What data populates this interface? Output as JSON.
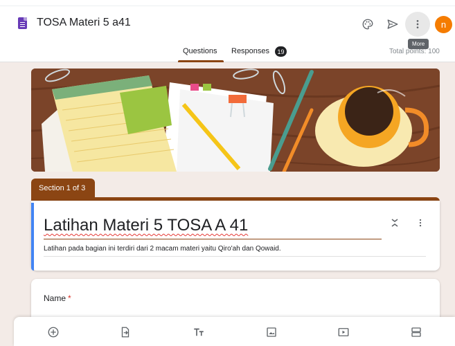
{
  "header": {
    "title": "TOSA Materi 5 a41",
    "tooltip": "More",
    "avatar_initial": "n",
    "icons": [
      "form-doc-icon",
      "palette-icon",
      "send-icon",
      "more-vert-icon"
    ],
    "colors": {
      "brand": "#673ab7",
      "avatar": "#f57c00",
      "theme": "#8b4513"
    }
  },
  "tabs": {
    "questions": "Questions",
    "responses": "Responses",
    "responses_count": "19",
    "total_points": "Total points: 100"
  },
  "section": {
    "tab_label": "Section 1 of 3"
  },
  "form": {
    "title": "Latihan Materi 5 TOSA A 41",
    "description": "Latihan pada bagian ini terdiri dari 2 macam materi yaitu Qiro'ah dan Qowaid.",
    "accent_color": "#4285f4"
  },
  "question": {
    "label": "Name",
    "required_mark": "*"
  },
  "toolbar": {
    "icons": [
      "add-question-icon",
      "import-questions-icon",
      "add-title-icon",
      "add-image-icon",
      "add-video-icon",
      "add-section-icon"
    ]
  }
}
